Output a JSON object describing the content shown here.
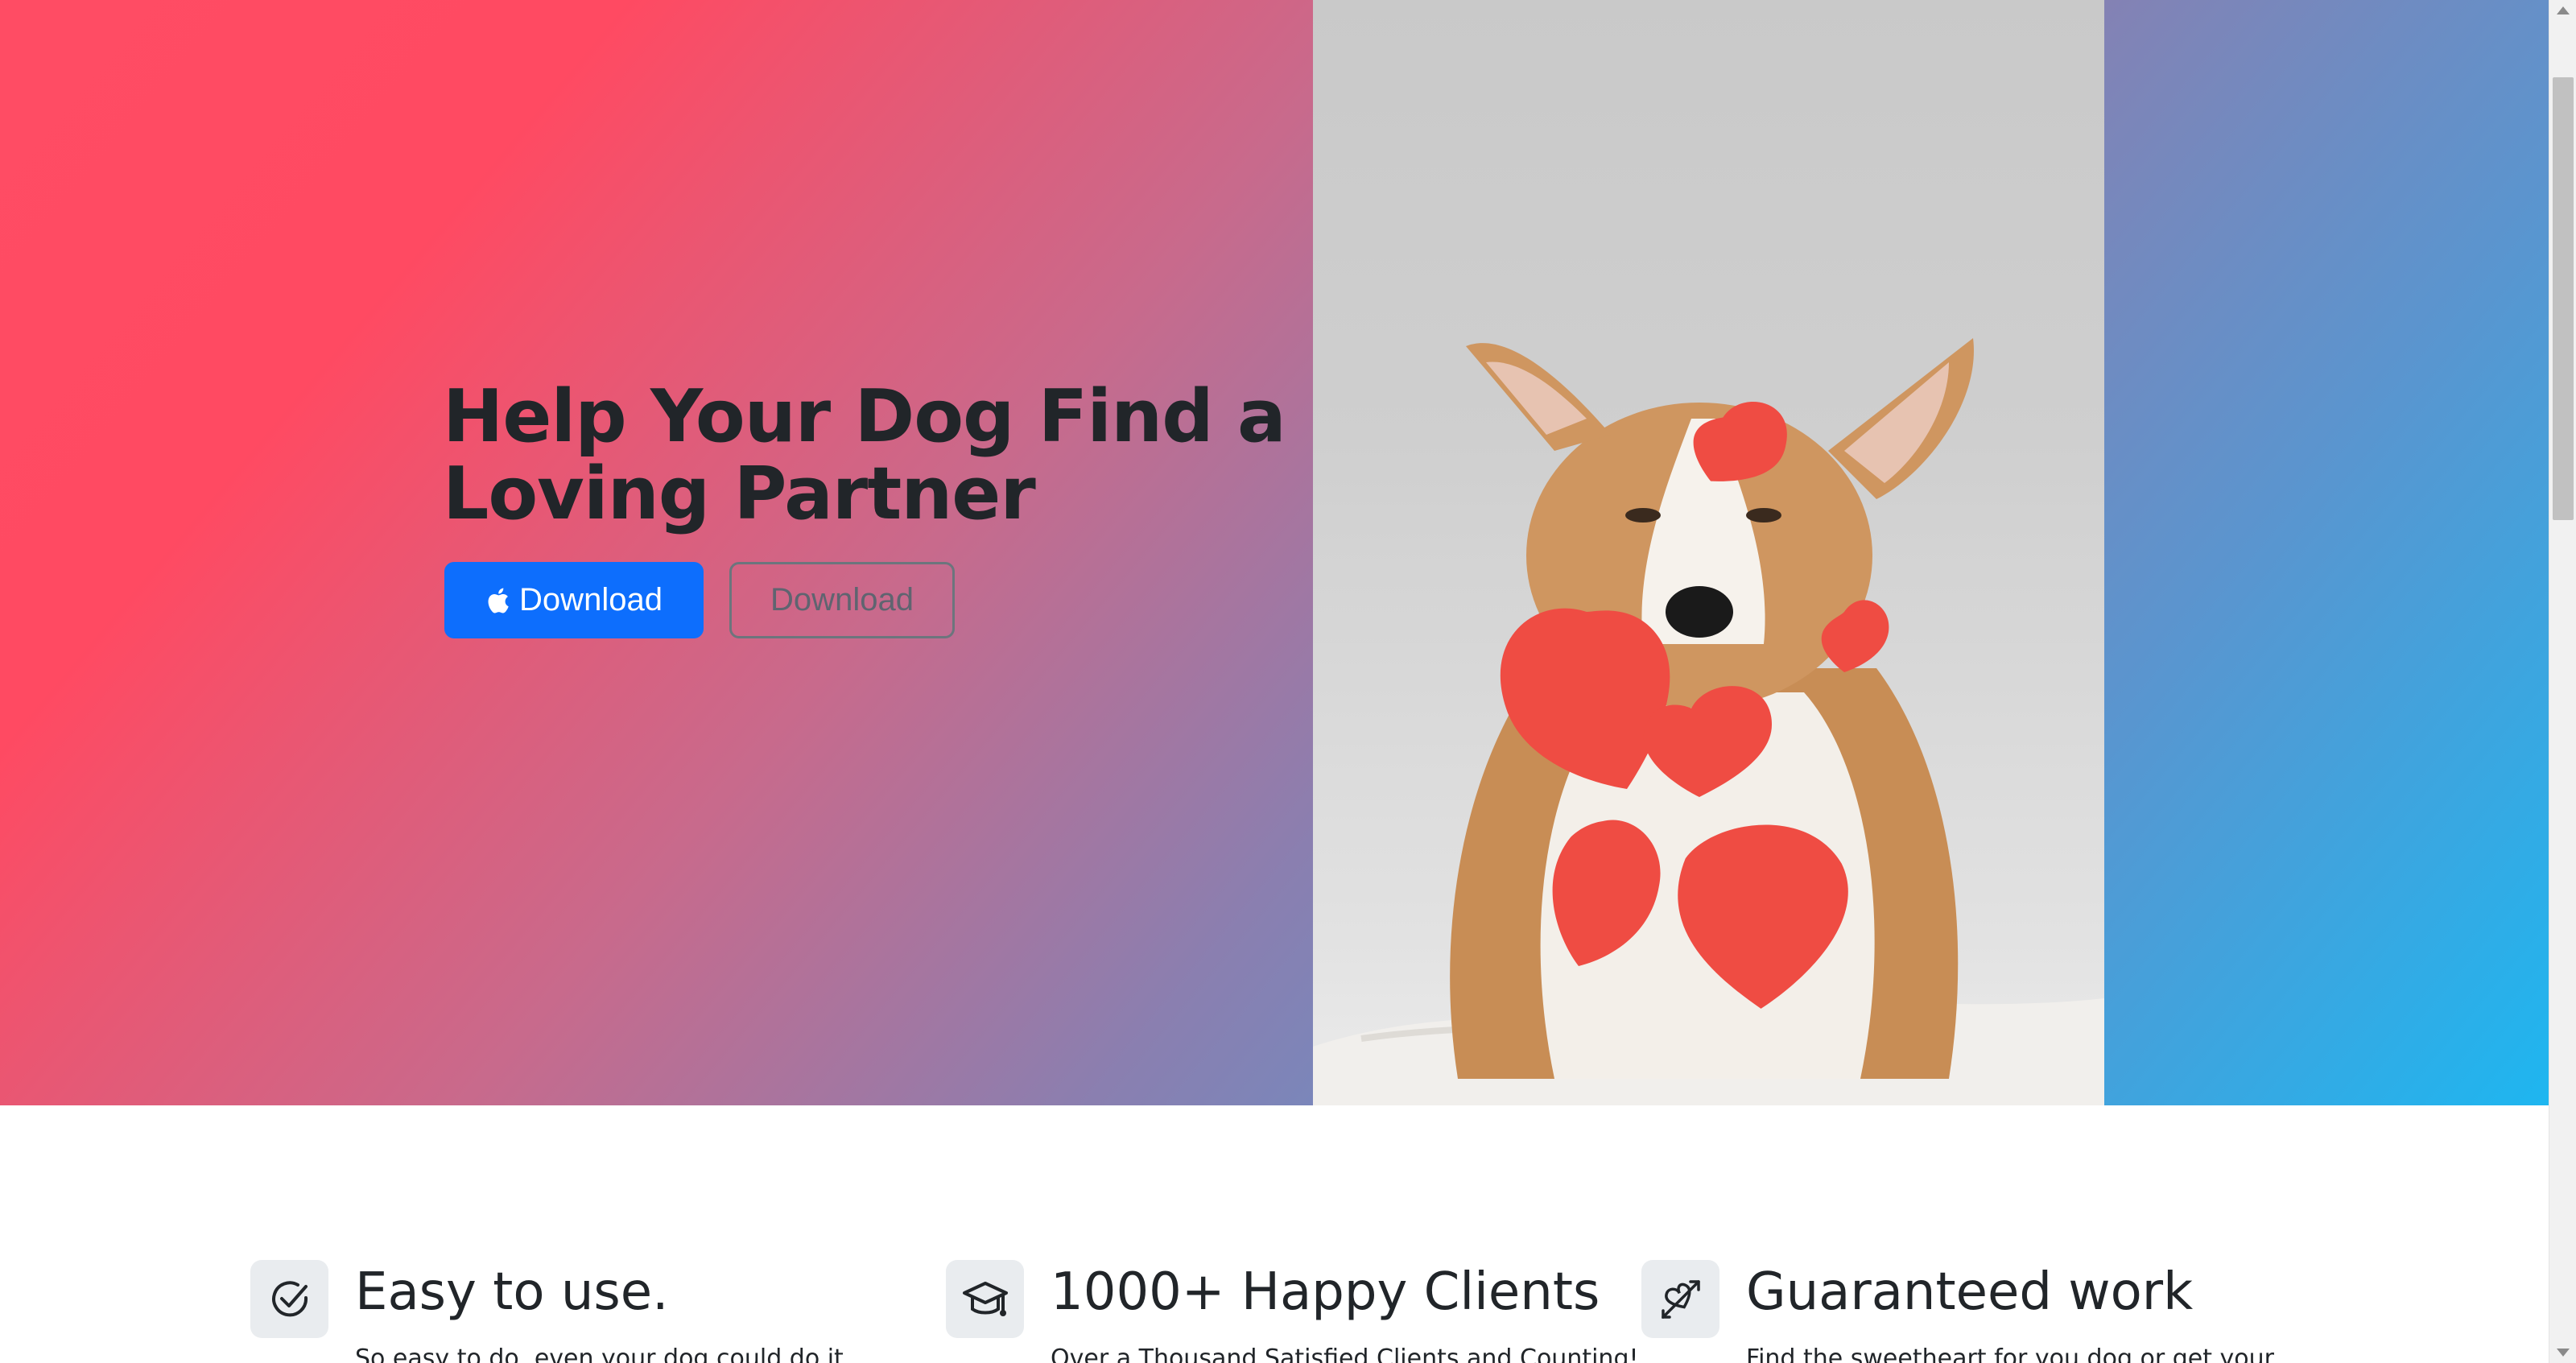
{
  "hero": {
    "title": "Help Your Dog Find a Loving Partner",
    "primary_button_label": "Download",
    "secondary_button_label": "Download",
    "image_alt": "Corgi with red paper hearts"
  },
  "features": [
    {
      "icon": "check-circle-icon",
      "title": "Easy to use.",
      "text": "So easy to do, even your dog could do it."
    },
    {
      "icon": "graduation-cap-icon",
      "title": "1000+ Happy Clients",
      "text": "Over a Thousand Satisfied Clients and Counting!"
    },
    {
      "icon": "heart-arrow-icon",
      "title": "Guaranteed work",
      "text": "Find the sweetheart for you dog or get your"
    }
  ],
  "colors": {
    "gradient_start": "#ff4a62",
    "gradient_end": "#1eb6f0",
    "primary_button": "#0d6efd",
    "heading_text": "#212529"
  }
}
